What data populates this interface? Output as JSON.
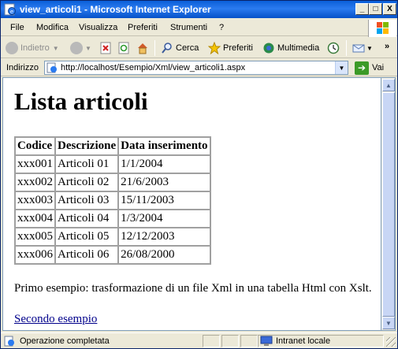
{
  "window": {
    "title": "view_articoli1 - Microsoft Internet Explorer",
    "controls": {
      "minimize": "_",
      "maximize": "□",
      "close": "X"
    }
  },
  "menu": [
    "File",
    "Modifica",
    "Visualizza",
    "Preferiti",
    "Strumenti",
    "?"
  ],
  "toolbar": {
    "back_label": "Indietro",
    "search_label": "Cerca",
    "favorites_label": "Preferiti",
    "multimedia_label": "Multimedia",
    "overflow": "»"
  },
  "address": {
    "label": "Indirizzo",
    "url": "http://localhost/Esempio/Xml/view_articoli1.aspx",
    "go_label": "Vai"
  },
  "page": {
    "heading": "Lista articoli",
    "table": {
      "headers": [
        "Codice",
        "Descrizione",
        "Data inserimento"
      ],
      "rows": [
        [
          "xxx001",
          "Articoli 01",
          "1/1/2004"
        ],
        [
          "xxx002",
          "Articoli 02",
          "21/6/2003"
        ],
        [
          "xxx003",
          "Articoli 03",
          "15/11/2003"
        ],
        [
          "xxx004",
          "Articoli 04",
          "1/3/2004"
        ],
        [
          "xxx005",
          "Articoli 05",
          "12/12/2003"
        ],
        [
          "xxx006",
          "Articoli 06",
          "26/08/2000"
        ]
      ]
    },
    "paragraph": "Primo esempio: trasformazione di un file Xml in una tabella Html con Xslt.",
    "link": "Secondo esempio"
  },
  "status": {
    "text": "Operazione completata",
    "zone": "Intranet locale"
  },
  "colors": {
    "titlebar": "#0a5fd8",
    "chrome": "#ece9d8",
    "link": "#00008b"
  }
}
